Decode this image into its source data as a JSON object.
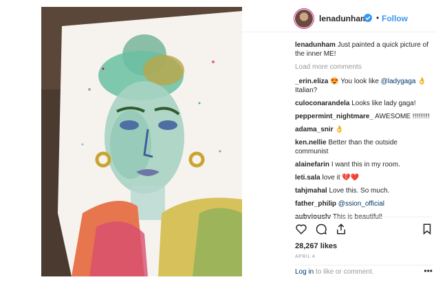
{
  "post": {
    "username": "lenadunham",
    "follow_label": "Follow",
    "separator": "•",
    "caption": "Just painted a quick picture of the inner ME!",
    "load_more": "Load more comments",
    "comments": [
      {
        "user": "_erin.eliza",
        "pre": "😍 You look like ",
        "mention": "@ladygaga",
        "post": " 👌 Italian?"
      },
      {
        "user": "culoconarandela",
        "text": "Looks like lady gaga!"
      },
      {
        "user": "peppermint_nightmare_",
        "text": "AWESOME !!!!!!!!!"
      },
      {
        "user": "adama_snir",
        "text": "👌"
      },
      {
        "user": "ken.nellie",
        "text": "Better than the outside communist"
      },
      {
        "user": "alainefarin",
        "text": "I want this in my room."
      },
      {
        "user": "leti.sala",
        "text": "love it 💔❤️"
      },
      {
        "user": "tahjmahal",
        "text": "Love this. So much."
      },
      {
        "user": "father_philip",
        "mention": "@ssion_official"
      },
      {
        "user": "aubviouslv",
        "text": "This is beautiful!"
      }
    ],
    "likes": "28,267 likes",
    "date": "APRIL 4",
    "login_link": "Log in",
    "login_rest": " to like or comment.",
    "more_options": "•••"
  },
  "icons": {
    "avatar": "avatar",
    "verified": "verified-badge-icon",
    "like": "heart-icon",
    "comment": "comment-bubble-icon",
    "share": "share-icon",
    "save": "bookmark-icon"
  },
  "colors": {
    "link_blue": "#3897f0",
    "mention": "#003569",
    "muted": "#999999"
  }
}
